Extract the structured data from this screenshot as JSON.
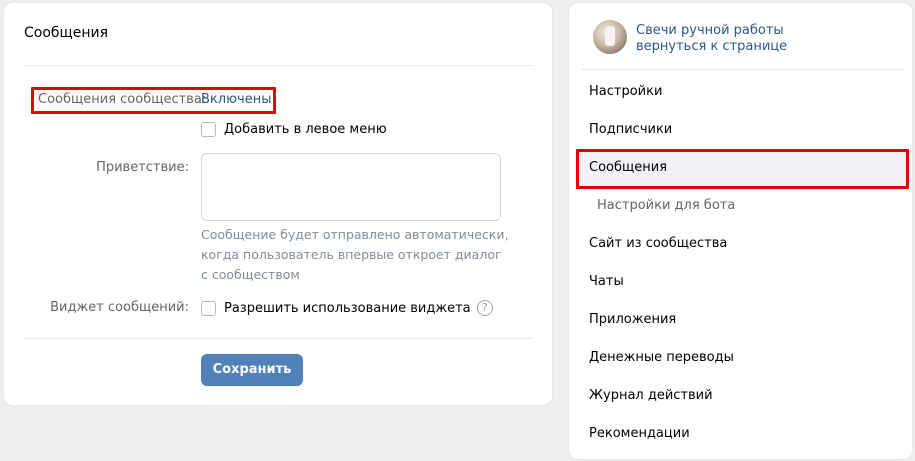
{
  "main": {
    "title": "Сообщения",
    "community_messages_label": "Сообщения сообщества:",
    "community_messages_value": "Включены",
    "add_left_menu_label": "Добавить в левое меню",
    "greeting_label": "Приветствие:",
    "greeting_value": "",
    "greeting_hint_lines": [
      "Сообщение будет отправлено автоматически,",
      "когда пользователь впервые откроет диалог",
      "с сообществом"
    ],
    "widget_label": "Виджет сообщений:",
    "widget_checkbox_label": "Разрешить использование виджета",
    "help_glyph": "?",
    "save_label": "Сохранить"
  },
  "sidebar": {
    "group_name": "Свечи ручной работы",
    "back_link": "вернуться к странице",
    "items": [
      {
        "label": "Настройки"
      },
      {
        "label": "Подписчики"
      },
      {
        "label": "Сообщения",
        "active": true
      },
      {
        "label": "Настройки для бота",
        "sub": true
      },
      {
        "label": "Сайт из сообщества"
      },
      {
        "label": "Чаты"
      },
      {
        "label": "Приложения"
      },
      {
        "label": "Денежные переводы"
      },
      {
        "label": "Журнал действий"
      },
      {
        "label": "Рекомендации"
      }
    ]
  },
  "colors": {
    "accent_link": "#2a5885",
    "button": "#5181b8",
    "highlight": "#e60000",
    "background": "#edeef0"
  }
}
